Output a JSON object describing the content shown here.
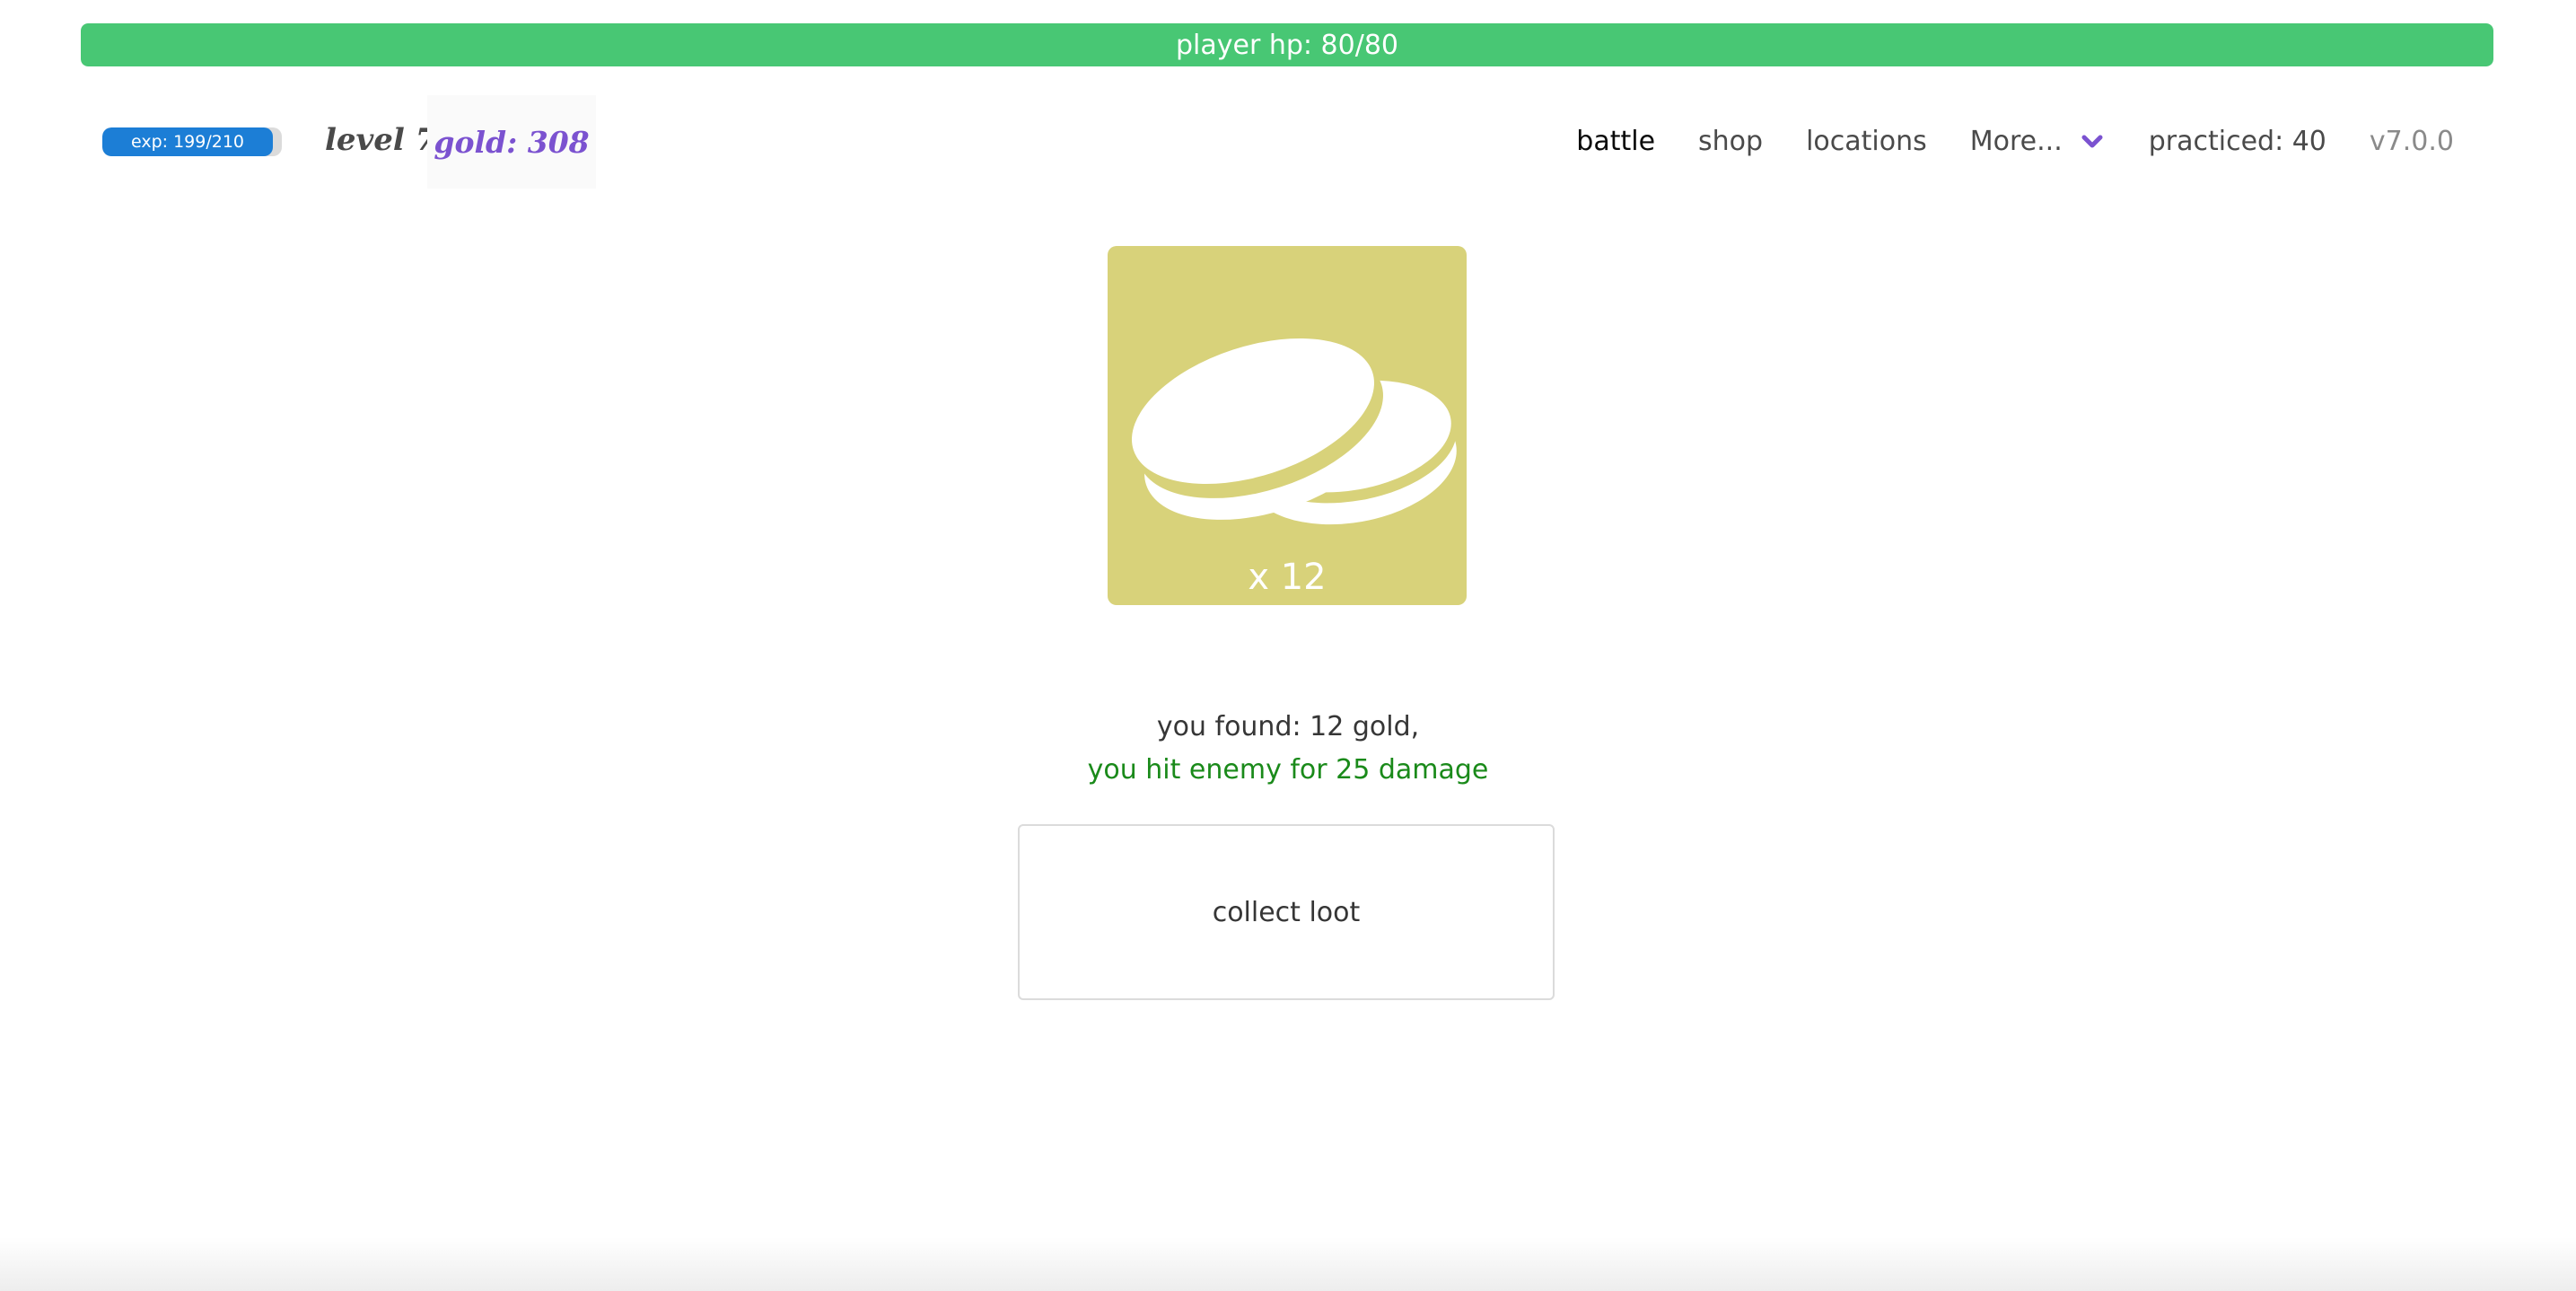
{
  "hp": {
    "label": "player hp: 80/80",
    "current": 80,
    "max": 80,
    "color": "#48c774"
  },
  "exp": {
    "label": "exp: 199/210",
    "current": 199,
    "max": 210,
    "color": "#1c7ed6"
  },
  "level_label": "level 7",
  "gold_label": "gold: 308",
  "nav": {
    "battle": "battle",
    "shop": "shop",
    "locations": "locations",
    "more": "More...",
    "practiced": "practiced: 40",
    "version": "v7.0.0"
  },
  "loot": {
    "icon": "coins-icon",
    "count_label": "x 12",
    "card_color": "#d8d27a"
  },
  "messages": {
    "found": "you found: 12 gold,",
    "hit": "you hit enemy for 25 damage"
  },
  "collect_label": "collect loot"
}
